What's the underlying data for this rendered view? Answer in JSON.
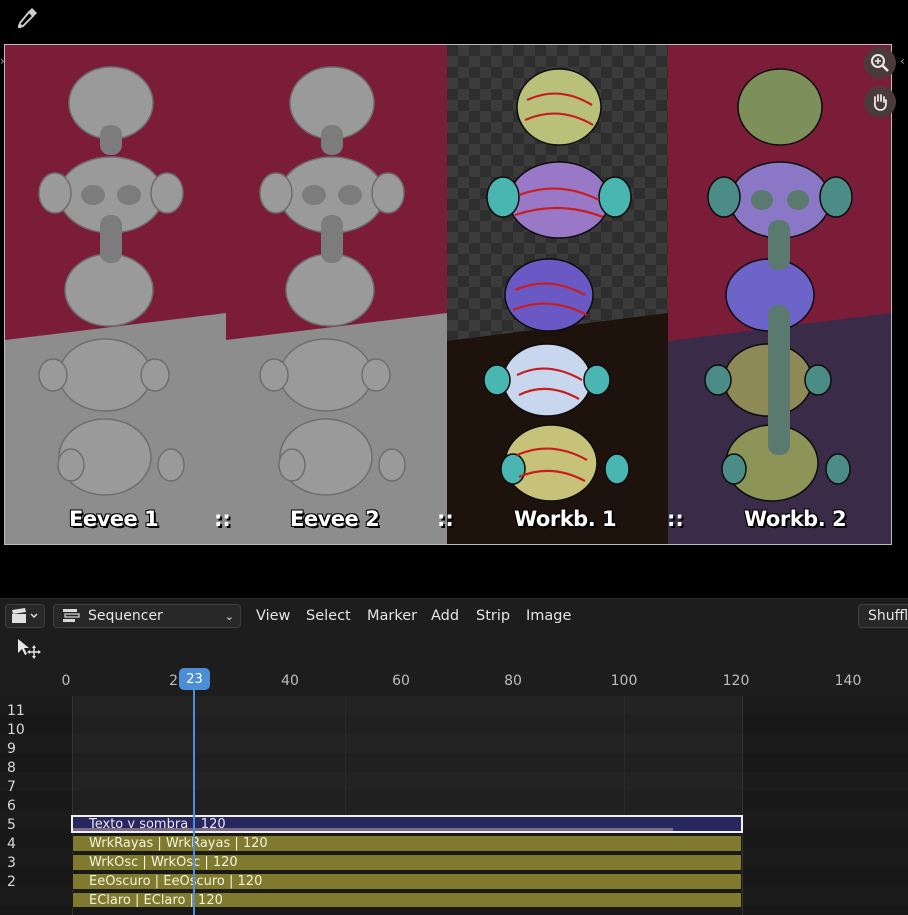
{
  "preview": {
    "labels": [
      "Eevee 1",
      "Eevee 2",
      "Workb. 1",
      "Workb. 2"
    ],
    "separator": "::",
    "colors": {
      "wall": "#7b1c39",
      "floor_gray": "#8d8d8d",
      "checker": "#2e2e2e"
    }
  },
  "header": {
    "editor_type": "Sequencer",
    "menus": [
      "View",
      "Select",
      "Marker",
      "Add",
      "Strip",
      "Image"
    ],
    "right_button": "Shuffle"
  },
  "timeline": {
    "ruler_ticks": [
      "0",
      "20",
      "40",
      "60",
      "80",
      "100",
      "120",
      "140"
    ],
    "current_frame": "23",
    "channel_numbers": [
      "11",
      "10",
      "9",
      "8",
      "7",
      "6",
      "5",
      "4",
      "3",
      "2"
    ],
    "strips": [
      {
        "channel": 5,
        "label": "Texto y sombra | 120",
        "type": "text"
      },
      {
        "channel": 4,
        "label": "WrkRayas | WrkRayas | 120",
        "type": "scene"
      },
      {
        "channel": 3,
        "label": "WrkOsc | WrkOsc | 120",
        "type": "scene"
      },
      {
        "channel": 2,
        "label": "EeOscuro | EeOscuro | 120",
        "type": "scene"
      },
      {
        "channel": 1,
        "label": "EClaro | EClaro | 120",
        "type": "scene"
      }
    ],
    "colors": {
      "scene_strip": "#7f7a2d",
      "text_strip": "#28275f",
      "playhead": "#4b8ed6"
    }
  }
}
